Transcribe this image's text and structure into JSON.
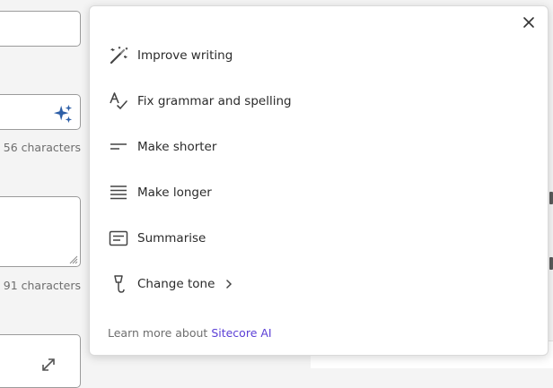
{
  "form": {
    "counter_1": "56 characters",
    "counter_2": "91 characters"
  },
  "menu": {
    "items": [
      {
        "label": "Improve writing",
        "icon": "magic-wand-icon"
      },
      {
        "label": "Fix grammar and spelling",
        "icon": "spellcheck-icon"
      },
      {
        "label": "Make shorter",
        "icon": "short-text-icon"
      },
      {
        "label": "Make longer",
        "icon": "long-text-icon"
      },
      {
        "label": "Summarise",
        "icon": "summary-icon"
      },
      {
        "label": "Change tone",
        "icon": "microphone-icon",
        "has_submenu": true
      }
    ],
    "footer_text": "Learn more about ",
    "footer_link": "Sitecore AI"
  },
  "colors": {
    "accent": "#5b3fd6",
    "sparkle": "#2d5fa7",
    "text": "#2b2b2b",
    "muted": "#6e6e6e"
  }
}
